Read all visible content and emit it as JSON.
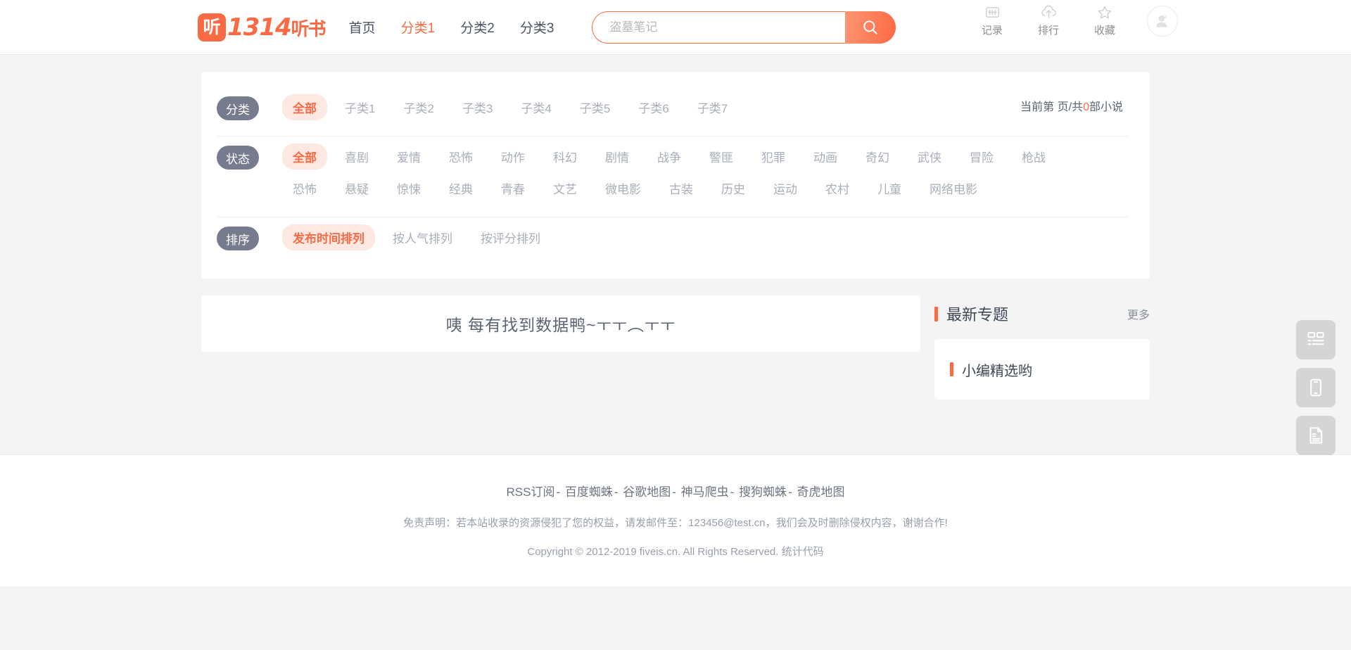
{
  "header": {
    "logo": {
      "badge": "听",
      "digits": "1314",
      "suffix": "听书"
    },
    "nav": [
      {
        "label": "首页",
        "active": false
      },
      {
        "label": "分类1",
        "active": true
      },
      {
        "label": "分类2",
        "active": false
      },
      {
        "label": "分类3",
        "active": false
      }
    ],
    "search": {
      "value": "",
      "placeholder": "盗墓笔记"
    },
    "right_items": [
      {
        "icon": "history-icon",
        "label": "记录"
      },
      {
        "icon": "ranking-cloud-icon",
        "label": "排行"
      },
      {
        "icon": "star-icon",
        "label": "收藏"
      }
    ],
    "avatar_icon": "user-avatar-icon"
  },
  "filters": {
    "rows": [
      {
        "badge": "分类",
        "items": [
          {
            "label": "全部",
            "active": true
          },
          {
            "label": "子类1",
            "active": false
          },
          {
            "label": "子类2",
            "active": false
          },
          {
            "label": "子类3",
            "active": false
          },
          {
            "label": "子类4",
            "active": false
          },
          {
            "label": "子类5",
            "active": false
          },
          {
            "label": "子类6",
            "active": false
          },
          {
            "label": "子类7",
            "active": false
          }
        ]
      },
      {
        "badge": "状态",
        "items": [
          {
            "label": "全部",
            "active": true
          },
          {
            "label": "喜剧",
            "active": false
          },
          {
            "label": "爱情",
            "active": false
          },
          {
            "label": "恐怖",
            "active": false
          },
          {
            "label": "动作",
            "active": false
          },
          {
            "label": "科幻",
            "active": false
          },
          {
            "label": "剧情",
            "active": false
          },
          {
            "label": "战争",
            "active": false
          },
          {
            "label": "警匪",
            "active": false
          },
          {
            "label": "犯罪",
            "active": false
          },
          {
            "label": "动画",
            "active": false
          },
          {
            "label": "奇幻",
            "active": false
          },
          {
            "label": "武侠",
            "active": false
          },
          {
            "label": "冒险",
            "active": false
          },
          {
            "label": "枪战",
            "active": false
          },
          {
            "label": "恐怖",
            "active": false
          },
          {
            "label": "悬疑",
            "active": false
          },
          {
            "label": "惊悚",
            "active": false
          },
          {
            "label": "经典",
            "active": false
          },
          {
            "label": "青春",
            "active": false
          },
          {
            "label": "文艺",
            "active": false
          },
          {
            "label": "微电影",
            "active": false
          },
          {
            "label": "古装",
            "active": false
          },
          {
            "label": "历史",
            "active": false
          },
          {
            "label": "运动",
            "active": false
          },
          {
            "label": "农村",
            "active": false
          },
          {
            "label": "儿童",
            "active": false
          },
          {
            "label": "网络电影",
            "active": false
          }
        ]
      },
      {
        "badge": "排序",
        "items": [
          {
            "label": "发布时间排列",
            "active": true
          },
          {
            "label": "按人气排列",
            "active": false
          },
          {
            "label": "按评分排列",
            "active": false
          }
        ]
      }
    ],
    "page_count": {
      "prefix": "当前第 页/共",
      "number": "0",
      "suffix": "部小说"
    }
  },
  "main": {
    "empty_text": "咦 每有找到数据鸭~ㅜㅜ︵ㅜㅜ"
  },
  "sidebar": {
    "title": "最新专题",
    "more": "更多",
    "cards": [
      {
        "title": "小编精选哟"
      }
    ]
  },
  "footer": {
    "links": [
      "RSS订阅",
      "百度蜘蛛",
      "谷歌地图",
      "神马爬虫",
      "搜狗蜘蛛",
      "奇虎地图"
    ],
    "separator": "- ",
    "disclaimer": "免责声明：若本站收录的资源侵犯了您的权益，请发邮件至：123456@test.cn，我们会及时删除侵权内容，谢谢合作!",
    "copyright": "Copyright © 2012-2019 fiveis.cn. All Rights Reserved. 统计代码"
  },
  "float_side": [
    {
      "icon": "layout-grid-icon"
    },
    {
      "icon": "mobile-phone-icon"
    },
    {
      "icon": "document-icon"
    }
  ],
  "colors": {
    "accent": "#fa6a45",
    "accent_soft": "#fde9e2",
    "badge": "#767b8d",
    "text": "#4c5463",
    "muted": "#a9aeb8"
  }
}
